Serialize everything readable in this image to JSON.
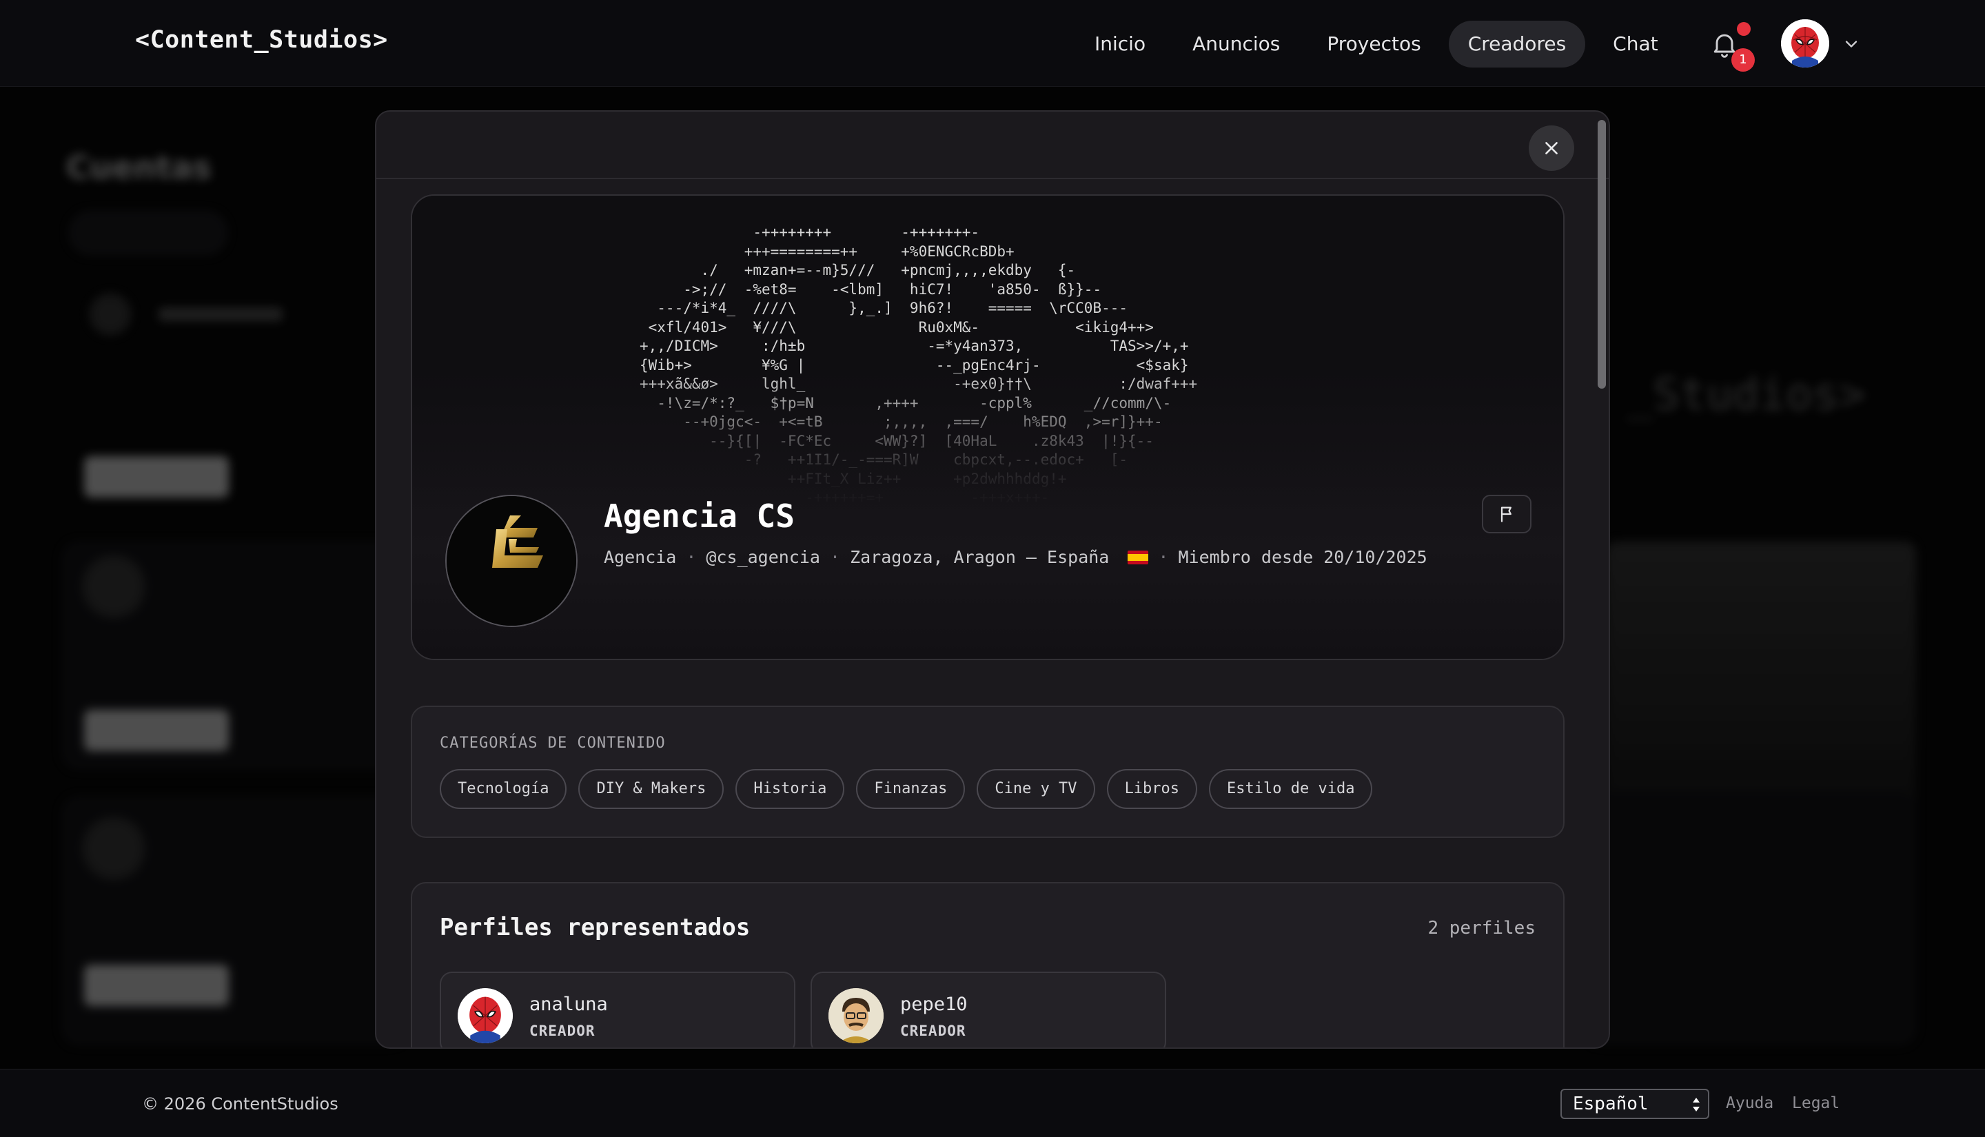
{
  "header": {
    "brand": "<Content_Studios>",
    "nav": [
      {
        "label": "Inicio",
        "active": false
      },
      {
        "label": "Anuncios",
        "active": false
      },
      {
        "label": "Proyectos",
        "active": false
      },
      {
        "label": "Creadores",
        "active": true
      },
      {
        "label": "Chat",
        "active": false
      }
    ],
    "notifications_count": "1",
    "bell_icon": "bell-icon",
    "user_menu_icon": "chevron-down-icon"
  },
  "background_page": {
    "title": "Cuentas",
    "studio_text": "_Studios>"
  },
  "modal": {
    "close_icon": "close-icon",
    "profile": {
      "name": "Agencia CS",
      "type": "Agencia",
      "handle": "@cs_agencia",
      "location": "Zaragoza, Aragon — España",
      "country_flag": "🇪🇸",
      "member_since": "Miembro desde 20/10/2025",
      "report_icon": "flag-icon",
      "banner_ascii": [
        "             -++++++++        -+++++++-",
        "            +++========++     +%0ENGCRcBDb+",
        "       ./   +mzan+=--m}5///   +pncmj,,,,ekdby   {-",
        "     ->;//  -%et8=    -<lbm]   hiC7!    'a850-  ß}}--",
        "  ---/*i*4_  ////\\      },_.]  9h6?!    =====  \\rCC0B---",
        " <xfl/401>   ¥///\\              Ru0xM&-           <ikig4++>",
        "+,,/DICM>     :/h±b              -=*y4an373,          TAS>>/+,+",
        "{Wib+>        ¥%G |               --_pgEnc4rj-           <$sak}",
        "+++xã&&ø>     lghl_                 -+ex0}††\\          :/dwaf+++",
        "  -!\\z=/*:?_   $†p=N       ,++++       -cppl%      _//comm/\\-",
        "     --+0jgc<-  +<=tB       ;,,,,  ,===/    h%EDQ  ,>=r]}++-",
        "        --}{[|  -FC*Ec     <WW}?]  [40HaL    .z8k43  |!}{--",
        "            -?   ++1I1/-_-===R]W    cbpcxt,--.edoc+   [-",
        "                 ++FIt_X Liz++      +p2dwhhhddg!+",
        "                   -++++++=+          -+++x+++-"
      ]
    },
    "categories": {
      "label": "CATEGORÍAS DE CONTENIDO",
      "items": [
        "Tecnología",
        "DIY & Makers",
        "Historia",
        "Finanzas",
        "Cine y TV",
        "Libros",
        "Estilo de vida"
      ]
    },
    "represented": {
      "title": "Perfiles representados",
      "count": "2 perfiles",
      "profiles": [
        {
          "username": "analuna",
          "role": "CREADOR",
          "avatar": "spiderman-avatar"
        },
        {
          "username": "pepe10",
          "role": "CREADOR",
          "avatar": "cartoon-man-avatar"
        }
      ]
    }
  },
  "footer": {
    "copyright": "© 2026 ContentStudios",
    "language": "Español",
    "links": [
      "Ayuda",
      "Legal"
    ]
  }
}
